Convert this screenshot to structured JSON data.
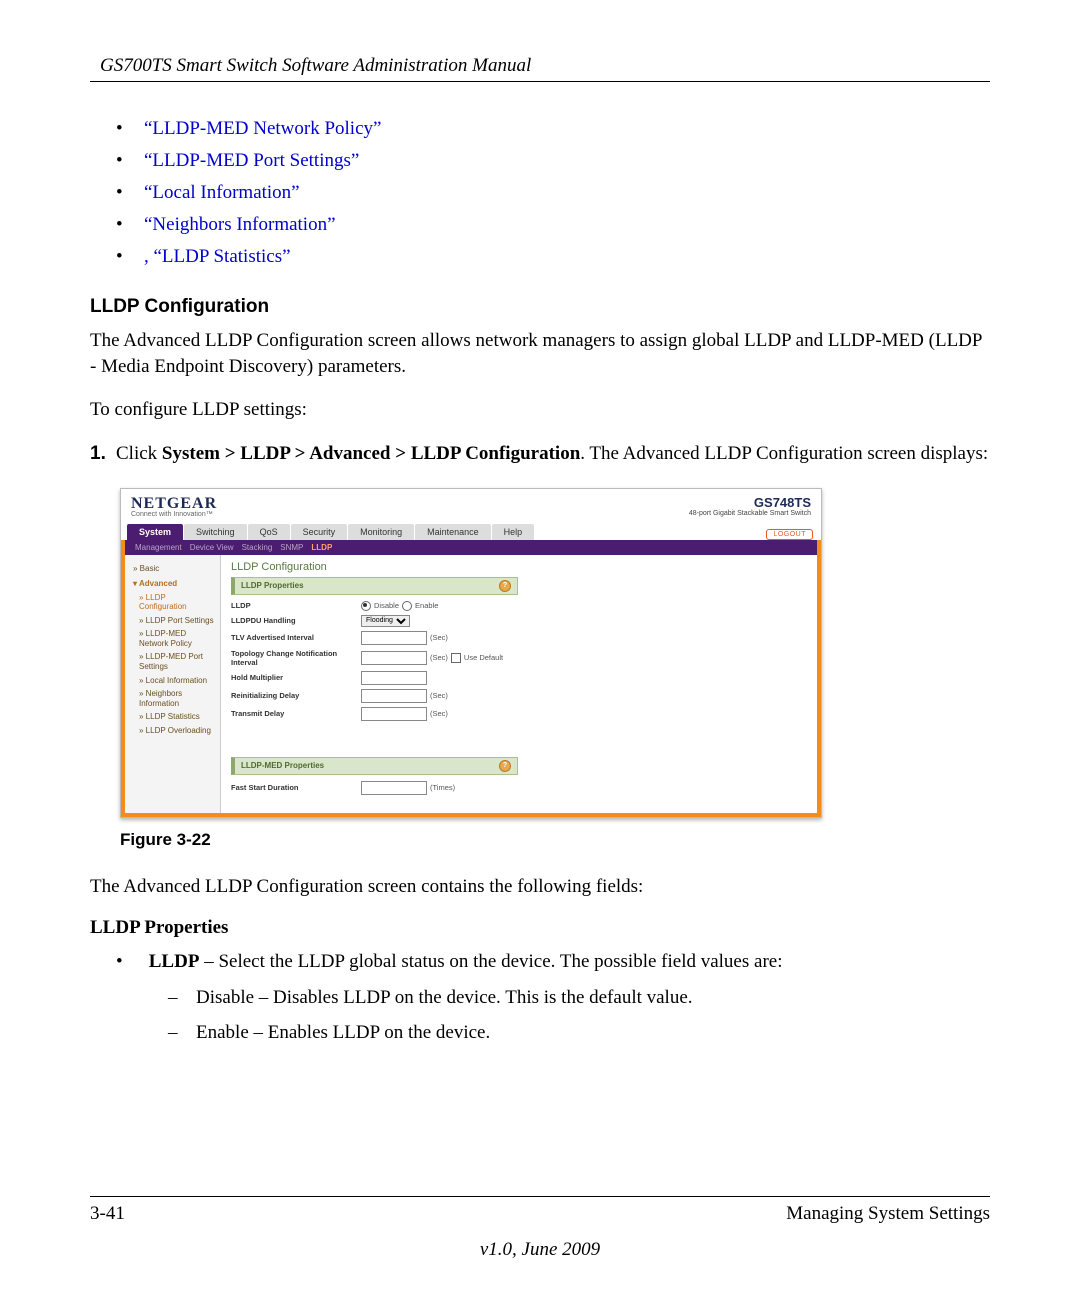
{
  "header": {
    "running": "GS700TS Smart Switch Software Administration Manual"
  },
  "links": [
    "“LLDP-MED Network Policy”",
    "“LLDP-MED Port Settings”",
    "“Local Information”",
    "“Neighbors Information”",
    ", “LLDP Statistics”"
  ],
  "section_title": "LLDP Configuration",
  "body1": "The Advanced LLDP Configuration screen allows network managers to assign global LLDP and LLDP-MED (LLDP - Media Endpoint Discovery) parameters.",
  "body2": "To configure LLDP settings:",
  "step1_num": "1.",
  "step1_pre": "Click ",
  "step1_path": "System > LLDP > Advanced > LLDP Configuration",
  "step1_post": ". The Advanced LLDP Configuration screen displays:",
  "figure_caption": "Figure 3-22",
  "body3": "The Advanced LLDP Configuration screen contains the following fields:",
  "props_head": "LLDP Properties",
  "lldp_label": "LLDP",
  "lldp_desc": " – Select the LLDP global status on the device. The possible field values are:",
  "lldp_vals": [
    "Disable – Disables LLDP on the device. This is the default value.",
    "Enable – Enables LLDP on the device."
  ],
  "footer": {
    "left": "3-41",
    "right": "Managing System Settings",
    "version": "v1.0, June 2009"
  },
  "mock": {
    "logo": "NETGEAR",
    "tagline": "Connect with Innovation™",
    "product_id": "GS748TS",
    "product_desc": "48-port Gigabit Stackable Smart Switch",
    "tabs": [
      "System",
      "Switching",
      "QoS",
      "Security",
      "Monitoring",
      "Maintenance",
      "Help"
    ],
    "logout": "LOGOUT",
    "subnav": [
      "Management",
      "Device View",
      "Stacking",
      "SNMP",
      "LLDP"
    ],
    "side": {
      "basic": "Basic",
      "advanced": "Advanced",
      "items": [
        "LLDP Configuration",
        "LLDP Port Settings",
        "LLDP-MED Network Policy",
        "LLDP-MED Port Settings",
        "Local Information",
        "Neighbors Information",
        "LLDP Statistics",
        "LLDP Overloading"
      ]
    },
    "main_title": "LLDP Configuration",
    "panel1": "LLDP Properties",
    "rows": {
      "lldp": "LLDP",
      "disable": "Disable",
      "enable": "Enable",
      "handling": "LLDPDU Handling",
      "handling_val": "Flooding",
      "tlv": "TLV Advertised Interval",
      "topo": "Topology Change Notification Interval",
      "hold": "Hold Multiplier",
      "reinit": "Reinitializing Delay",
      "transmit": "Transmit Delay",
      "sec": "(Sec)",
      "use_default": "Use Default"
    },
    "panel2": "LLDP-MED Properties",
    "fast_start": "Fast Start Duration",
    "times": "(Times)"
  }
}
